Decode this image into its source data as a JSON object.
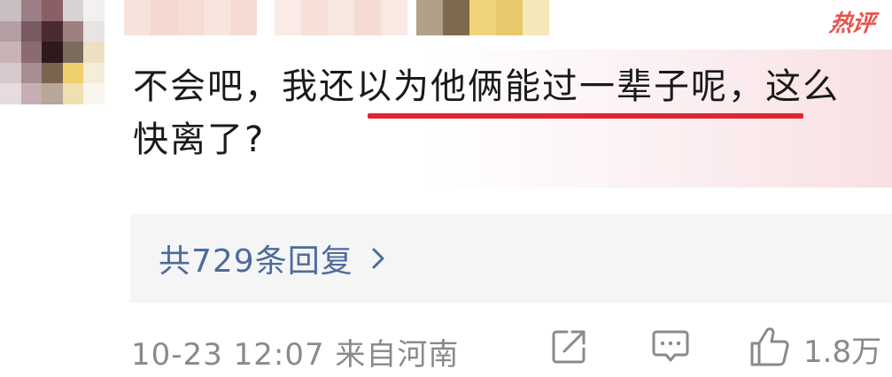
{
  "comment": {
    "badge": "热评",
    "text": "不会吧，我还以为他俩能过一辈子呢，这么快离了?"
  },
  "replies": {
    "label": "共729条回复",
    "chevron_icon": "chevron-right-icon"
  },
  "meta": {
    "time_location": "10-23 12:07  来自河南"
  },
  "actions": {
    "share_icon": "share-icon",
    "reply_icon": "comment-icon",
    "like_icon": "thumbs-up-icon",
    "like_count": "1.8万"
  },
  "colors": {
    "badge": "#e8534a",
    "underline": "#e5232f",
    "link": "#4c6c9c",
    "meta": "#8a8a8a",
    "reply_bg": "#f5f5f6",
    "bubble_tint": "#f8e0e4"
  }
}
